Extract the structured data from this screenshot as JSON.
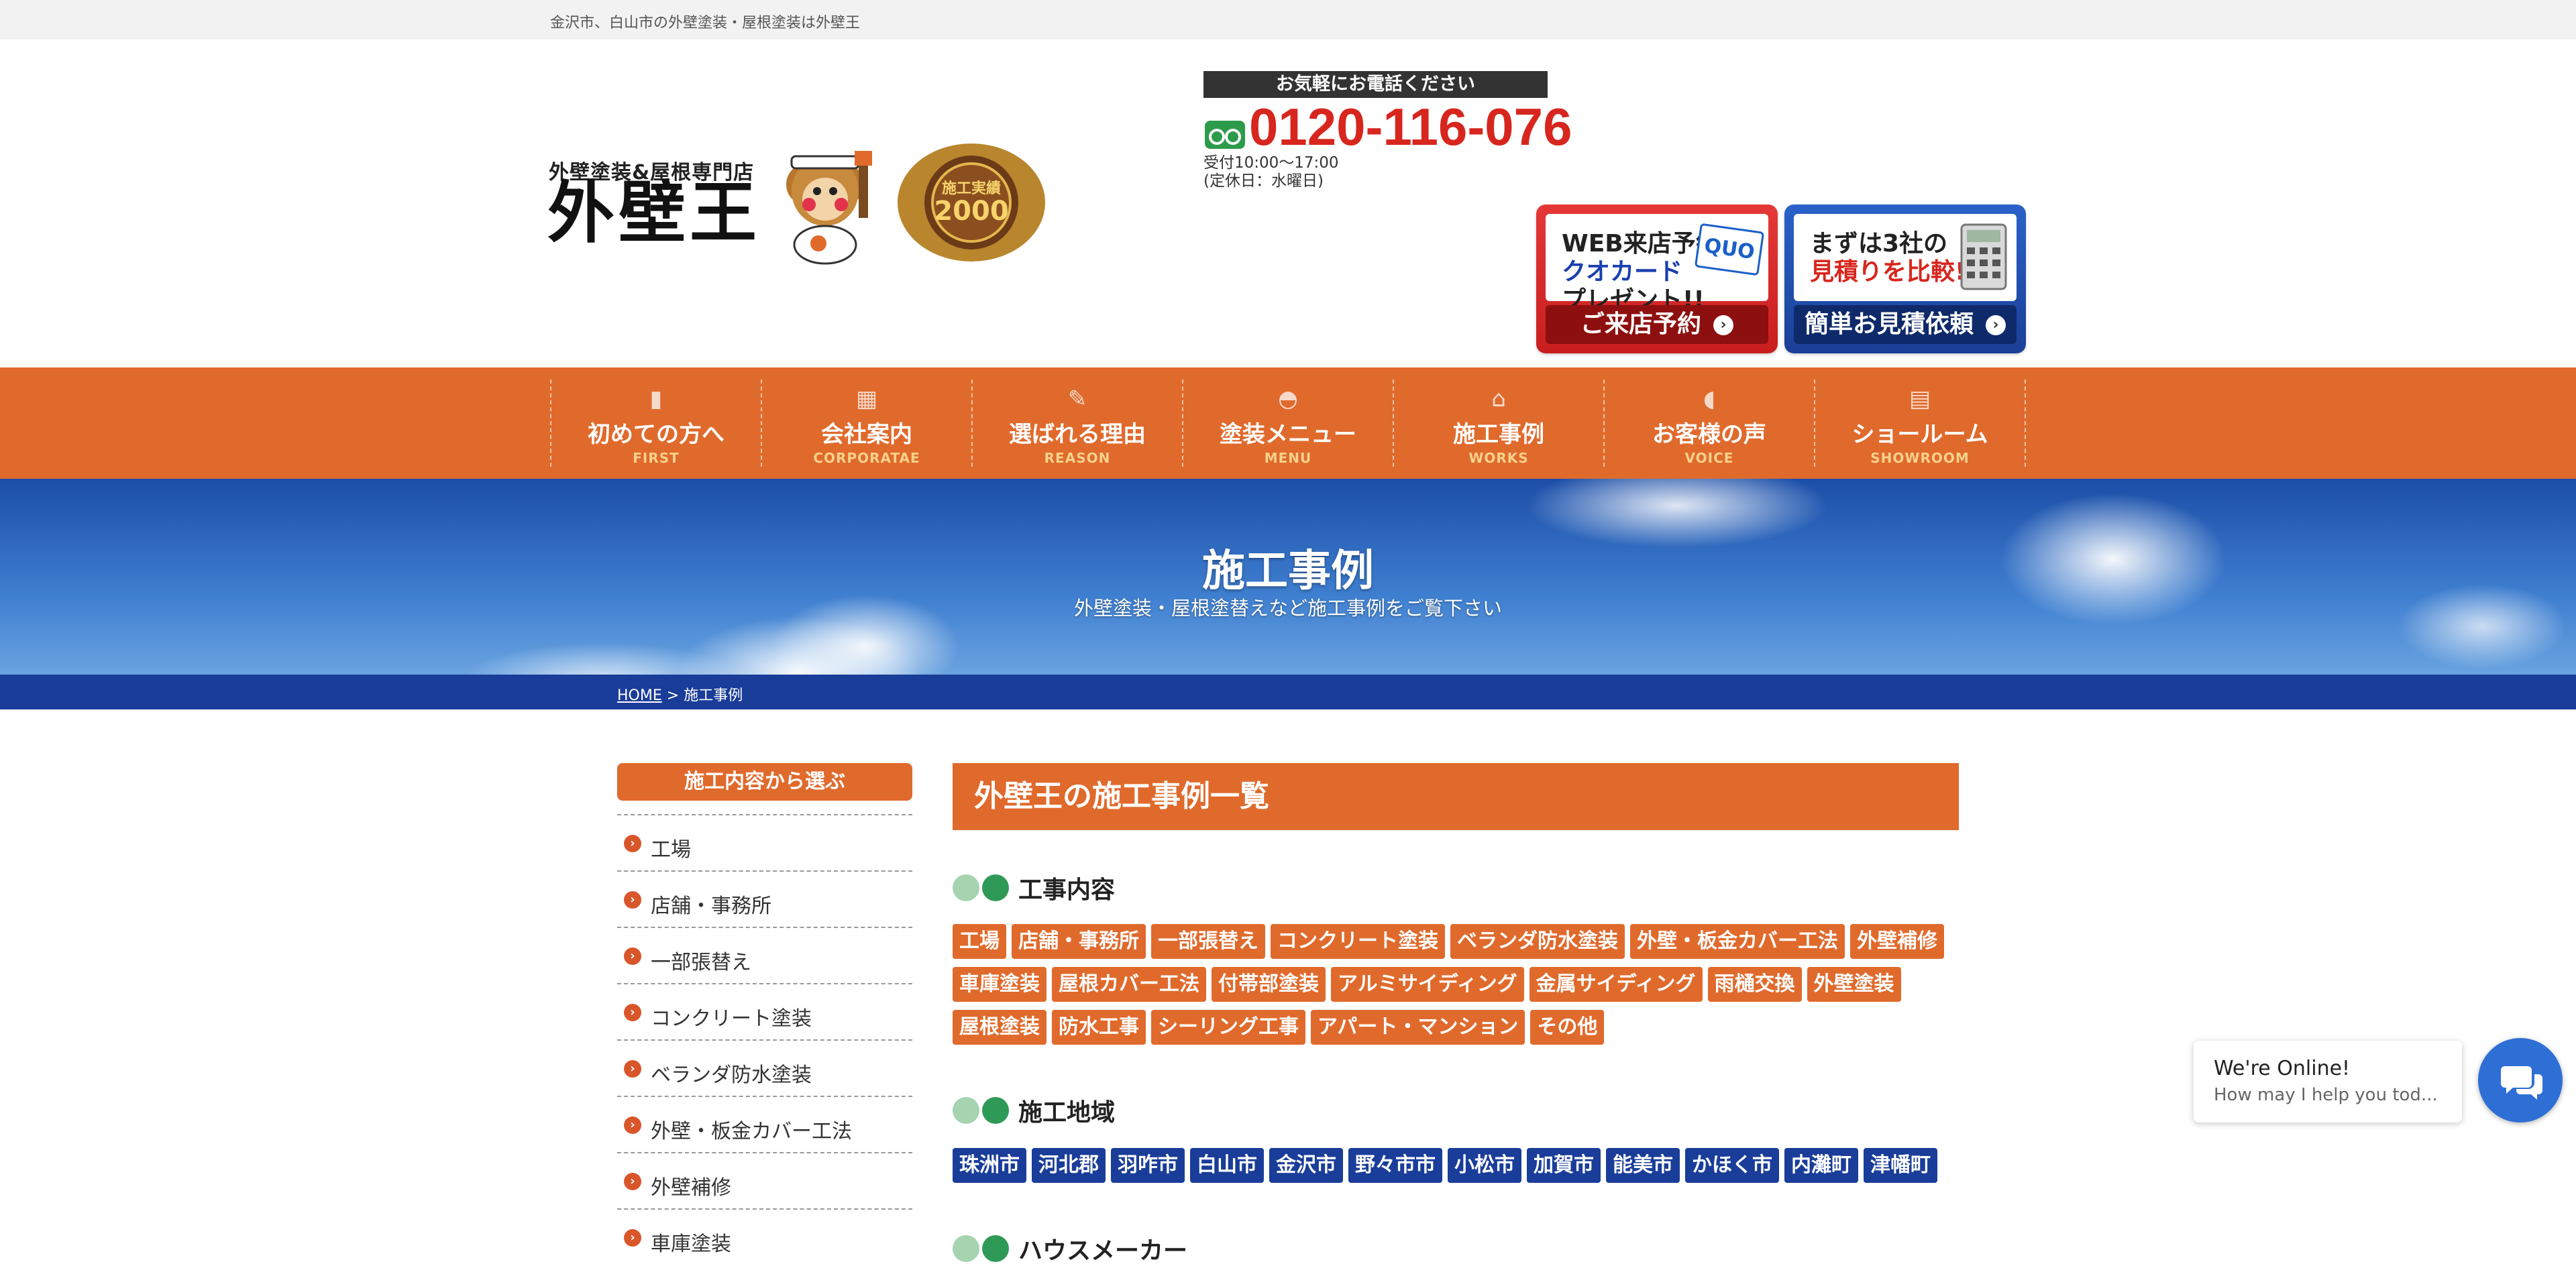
{
  "topbar": {
    "tagline": "金沢市、白山市の外壁塗装・屋根塗装は外壁王"
  },
  "logo": {
    "subtitle": "外壁塗装&屋根専門店",
    "name": "外壁王",
    "medal_line1": "施工実績",
    "medal_line2": "2000"
  },
  "contact": {
    "call_label": "お気軽にお電話ください",
    "phone": "0120-116-076",
    "hours_line1": "受付10:00〜17:00",
    "hours_line2": "(定休日：水曜日)"
  },
  "banners": {
    "visit": {
      "line1": "WEB来店予約で",
      "line2": "クオカード",
      "line3": "プレゼント!!",
      "cta": "ご来店予約",
      "badge": "QUO"
    },
    "estimate": {
      "line1": "まずは3社の",
      "line2": "見積りを比較!!",
      "cta": "簡単お見積依頼"
    }
  },
  "nav": [
    {
      "label": "初めての方へ",
      "en": "FIRST",
      "icon": "book-icon"
    },
    {
      "label": "会社案内",
      "en": "CORPORATAE",
      "icon": "building-icon"
    },
    {
      "label": "選ばれる理由",
      "en": "REASON",
      "icon": "brush-icon"
    },
    {
      "label": "塗装メニュー",
      "en": "MENU",
      "icon": "helmet-icon"
    },
    {
      "label": "施工事例",
      "en": "WORKS",
      "icon": "house-icon"
    },
    {
      "label": "お客様の声",
      "en": "VOICE",
      "icon": "speaker-icon"
    },
    {
      "label": "ショールーム",
      "en": "SHOWROOM",
      "icon": "store-icon"
    }
  ],
  "hero": {
    "title": "施工事例",
    "subtitle": "外壁塗装・屋根塗替えなど施工事例をご覧下さい"
  },
  "breadcrumb": {
    "home": "HOME",
    "sep": ">",
    "current": "施工事例"
  },
  "sidebar": {
    "heading": "施工内容から選ぶ",
    "items": [
      "工場",
      "店舗・事務所",
      "一部張替え",
      "コンクリート塗装",
      "ベランダ防水塗装",
      "外壁・板金カバー工法",
      "外壁補修",
      "車庫塗装"
    ]
  },
  "main": {
    "heading": "外壁王の施工事例一覧",
    "sections": [
      {
        "title": "工事内容",
        "color": "orange",
        "tags": [
          "工場",
          "店舗・事務所",
          "一部張替え",
          "コンクリート塗装",
          "ベランダ防水塗装",
          "外壁・板金カバー工法",
          "外壁補修",
          "車庫塗装",
          "屋根カバー工法",
          "付帯部塗装",
          "アルミサイディング",
          "金属サイディング",
          "雨樋交換",
          "外壁塗装",
          "屋根塗装",
          "防水工事",
          "シーリング工事",
          "アパート・マンション",
          "その他"
        ]
      },
      {
        "title": "施工地域",
        "color": "navy",
        "tags": [
          "珠洲市",
          "河北郡",
          "羽咋市",
          "白山市",
          "金沢市",
          "野々市市",
          "小松市",
          "加賀市",
          "能美市",
          "かほく市",
          "内灘町",
          "津幡町"
        ]
      },
      {
        "title": "ハウスメーカー",
        "color": "orange",
        "tags": []
      }
    ]
  },
  "chat": {
    "line1": "We're Online!",
    "line2": "How may I help you tod..."
  },
  "colors": {
    "accent": "#e06a2c",
    "navy": "#1a3d99",
    "phone": "#d7261e"
  }
}
